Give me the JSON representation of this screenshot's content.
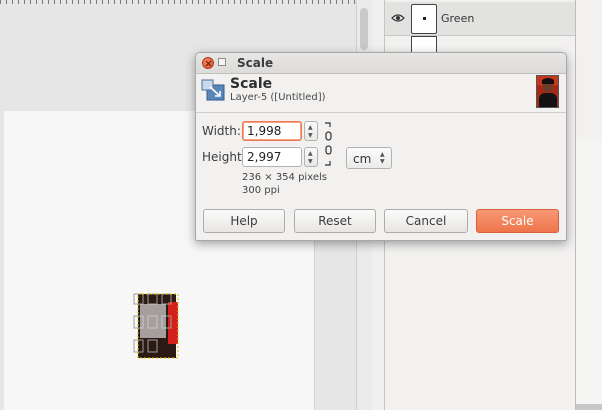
{
  "background": {
    "layers": [
      {
        "name": "Green"
      }
    ]
  },
  "dialog": {
    "window_title": "Scale",
    "header_title": "Scale",
    "header_subtitle": "Layer-5 ([Untitled])",
    "width_label": "Width:",
    "width_value": "1,998",
    "height_label": "Height:",
    "height_value": "2,997",
    "pixel_size": "236 × 354 pixels",
    "resolution": "300 ppi",
    "unit": "cm",
    "buttons": {
      "help": "Help",
      "reset": "Reset",
      "cancel": "Cancel",
      "scale": "Scale"
    },
    "colors": {
      "accent": "#ef754a",
      "focus_border": "#ef7a4d"
    }
  }
}
